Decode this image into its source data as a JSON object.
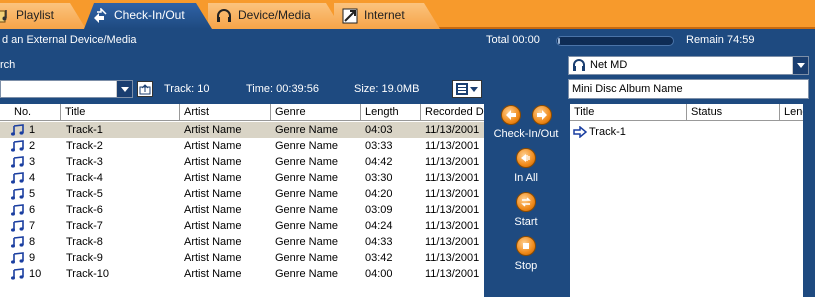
{
  "tabs": [
    {
      "label": "Playlist",
      "icon": "playlist-icon",
      "active": false
    },
    {
      "label": "Check-In/Out",
      "icon": "check-in-out-icon",
      "active": true
    },
    {
      "label": "Device/Media",
      "icon": "headphones-icon",
      "active": false
    },
    {
      "label": "Internet",
      "icon": "internet-icon",
      "active": false
    }
  ],
  "status": {
    "hint": "d an External Device/Media",
    "total": "Total 00:00",
    "remain": "Remain 74:59",
    "progress_fraction": 0.02
  },
  "search": {
    "label": "rch"
  },
  "device": {
    "selected": "Net MD",
    "album_name": "Mini Disc Album Name"
  },
  "info": {
    "track": "Track: 10",
    "time": "Time: 00:39:56",
    "size": "Size: 19.0MB"
  },
  "left_table": {
    "columns": [
      "No.",
      "Title",
      "Artist",
      "Genre",
      "Length",
      "Recorded D"
    ],
    "rows": [
      [
        "1",
        "Track-1",
        "Artist Name",
        "Genre Name",
        "04:03",
        "11/13/2001"
      ],
      [
        "2",
        "Track-2",
        "Artist Name",
        "Genre Name",
        "03:33",
        "11/13/2001"
      ],
      [
        "3",
        "Track-3",
        "Artist Name",
        "Genre Name",
        "04:42",
        "11/13/2001"
      ],
      [
        "4",
        "Track-4",
        "Artist Name",
        "Genre Name",
        "03:30",
        "11/13/2001"
      ],
      [
        "5",
        "Track-5",
        "Artist Name",
        "Genre Name",
        "04:20",
        "11/13/2001"
      ],
      [
        "6",
        "Track-6",
        "Artist Name",
        "Genre Name",
        "03:09",
        "11/13/2001"
      ],
      [
        "7",
        "Track-7",
        "Artist Name",
        "Genre Name",
        "04:24",
        "11/13/2001"
      ],
      [
        "8",
        "Track-8",
        "Artist Name",
        "Genre Name",
        "04:33",
        "11/13/2001"
      ],
      [
        "9",
        "Track-9",
        "Artist Name",
        "Genre Name",
        "03:42",
        "11/13/2001"
      ],
      [
        "10",
        "Track-10",
        "Artist Name",
        "Genre Name",
        "04:00",
        "11/13/2001"
      ]
    ],
    "selected_row": 0
  },
  "controls": {
    "checkinout": "Check-In/Out",
    "in_all": "In All",
    "start": "Start",
    "stop": "Stop"
  },
  "right_table": {
    "columns": [
      "Title",
      "Status",
      "Leng"
    ],
    "rows": [
      [
        "Track-1",
        "",
        ""
      ]
    ]
  },
  "colors": {
    "accent": "#f79a2c",
    "background": "#1e4a80"
  }
}
